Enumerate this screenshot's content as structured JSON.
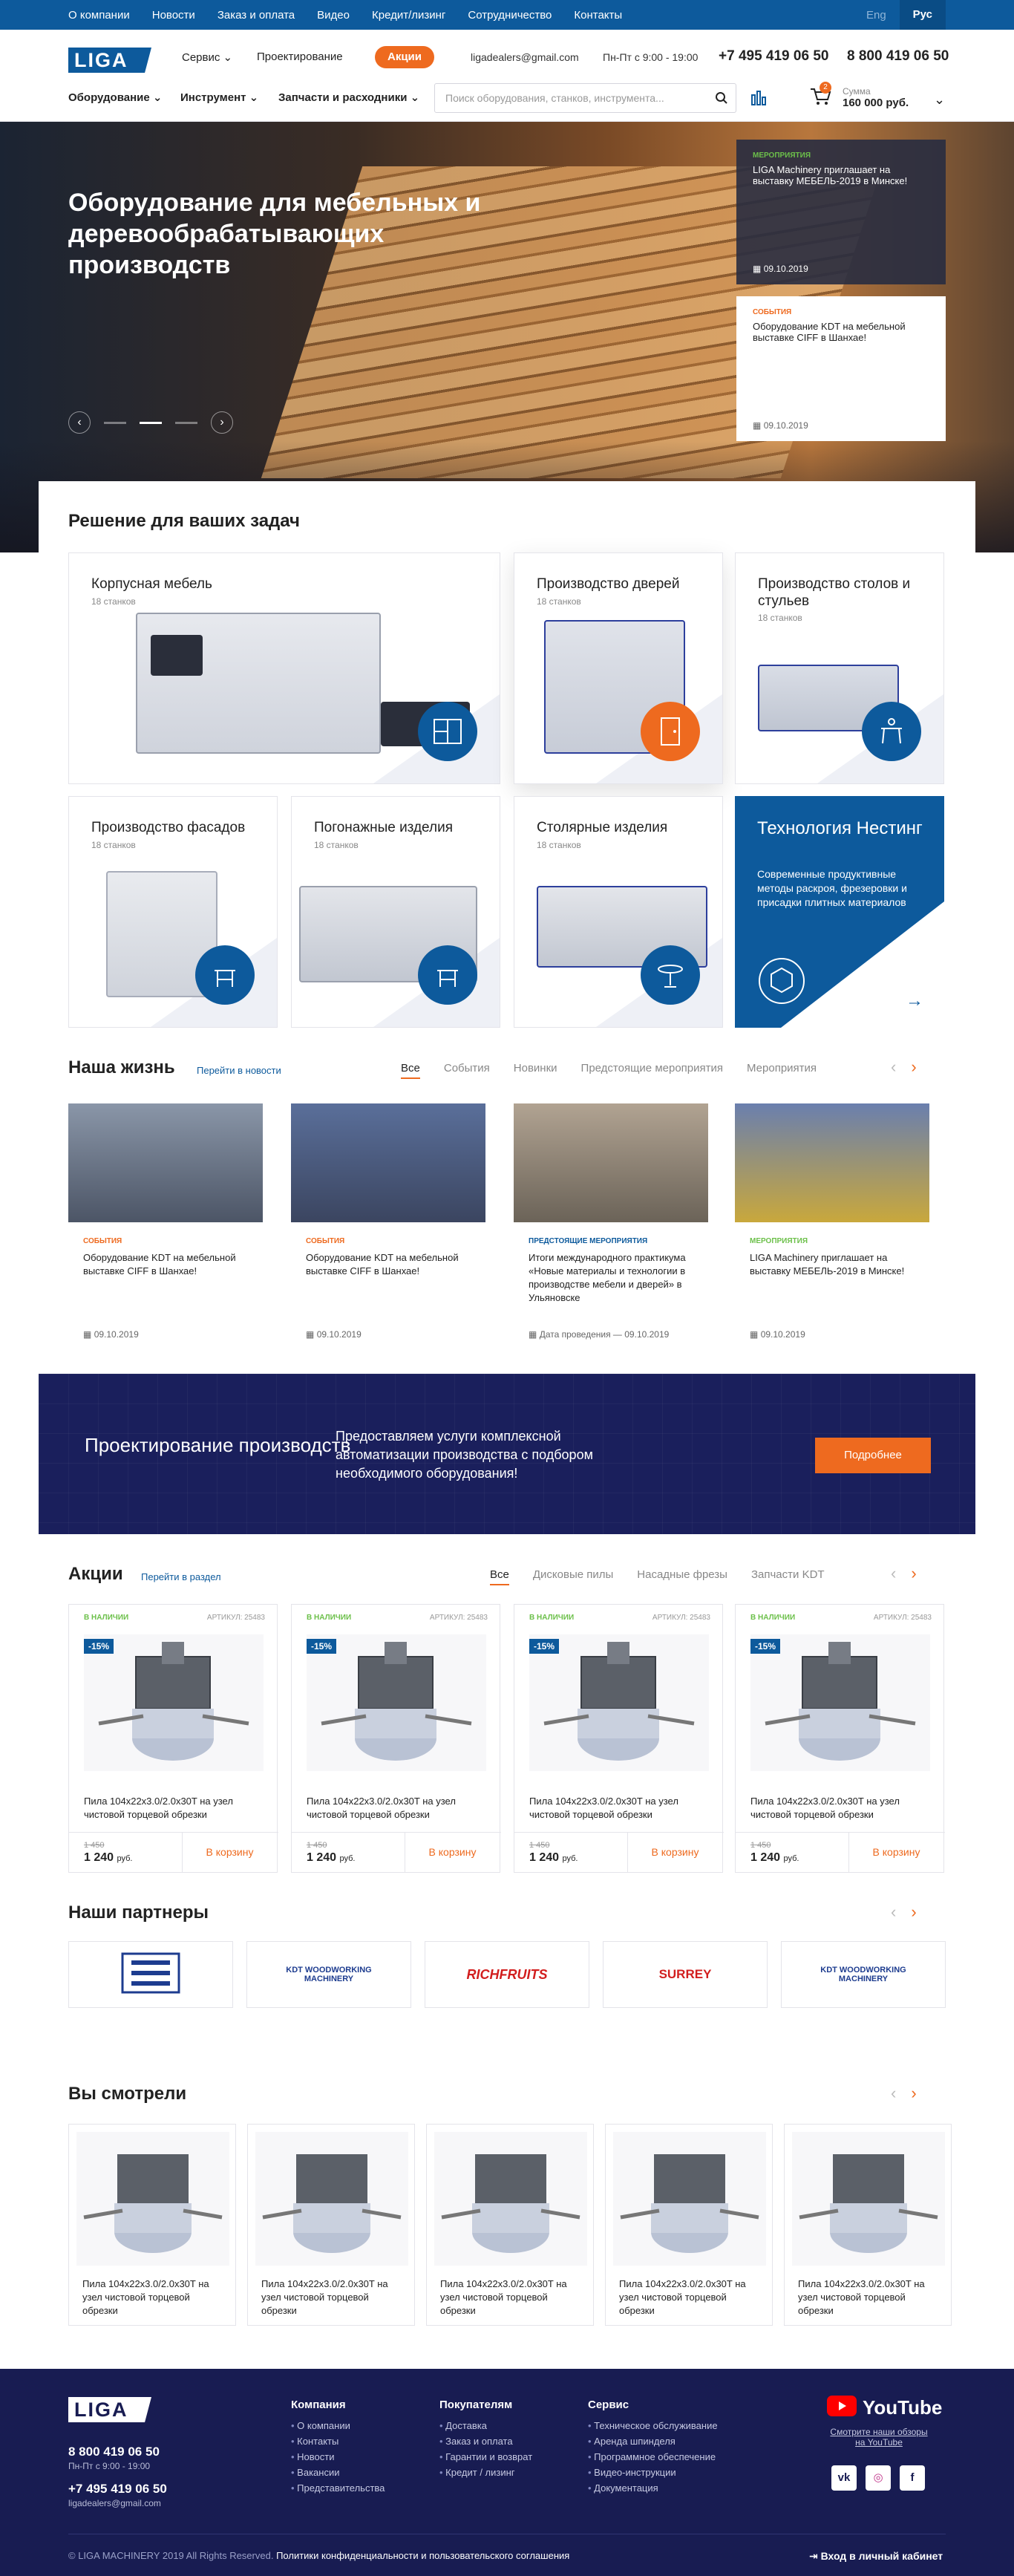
{
  "topbar": {
    "links": [
      "О компании",
      "Новости",
      "Заказ и оплата",
      "Видео",
      "Кредит/лизинг",
      "Сотрудничество",
      "Контакты"
    ],
    "lang_eng": "Eng",
    "lang_rus": "Рус"
  },
  "header": {
    "logo": "LIGA",
    "service": "Сервис",
    "design": "Проектирование",
    "promo": "Акции",
    "email": "ligadealers@gmail.com",
    "hours": "Пн-Пт с 9:00 - 19:00",
    "phone1": "+7 495 419 06 50",
    "phone2": "8 800 419 06 50",
    "menu": [
      "Оборудование",
      "Инструмент",
      "Запчасти и расходники"
    ],
    "search_placeholder": "Поиск оборудования, станков, инструмента...",
    "cart_count": "2",
    "cart_label": "Сумма",
    "cart_sum": "160 000 руб."
  },
  "hero": {
    "title": "Оборудование для мебельных и деревообрабатывающих производств",
    "prev": "‹",
    "next": "›",
    "news": [
      {
        "category": "МЕРОПРИЯТИЯ",
        "text": "LIGA Machinery приглашает на выставку МЕБЕЛЬ-2019 в Минске!",
        "date": "09.10.2019"
      },
      {
        "category": "СОБЫТИЯ",
        "text": "Оборудование KDT на мебельной выставке CIFF в Шанхае!",
        "date": "09.10.2019"
      }
    ]
  },
  "solutions": {
    "title": "Решение для ваших задач",
    "cards": [
      {
        "title": "Корпусная мебель",
        "sub": "18 станков"
      },
      {
        "title": "Производство дверей",
        "sub": "18 станков"
      },
      {
        "title": "Производство столов и стульев",
        "sub": "18 станков"
      },
      {
        "title": "Производство фасадов",
        "sub": "18 станков"
      },
      {
        "title": "Погонажные изделия",
        "sub": "18 станков"
      },
      {
        "title": "Столярные изделия",
        "sub": "18 станков"
      }
    ],
    "nesting_title": "Технология Нестинг",
    "nesting_text": "Современные продуктивные методы раскроя, фрезеровки и присадки плитных материалов"
  },
  "life": {
    "title": "Наша жизнь",
    "link": "Перейти в новости",
    "tabs": [
      "Все",
      "События",
      "Новинки",
      "Предстоящие мероприятия",
      "Мероприятия"
    ],
    "items": [
      {
        "category": "СОБЫТИЯ",
        "text": "Оборудование KDT на мебельной выставке CIFF в Шанхае!",
        "date": "09.10.2019",
        "color": "#ee6a1f"
      },
      {
        "category": "СОБЫТИЯ",
        "text": "Оборудование KDT на мебельной выставке CIFF в Шанхае!",
        "date": "09.10.2019",
        "color": "#ee6a1f"
      },
      {
        "category": "ПРЕДСТОЯЩИЕ МЕРОПРИЯТИЯ",
        "text": "Итоги международного практикума «Новые материалы и технологии в производстве мебели и дверей» в Ульяновске",
        "date": "Дата проведения — 09.10.2019",
        "color": "#0d5a9c"
      },
      {
        "category": "МЕРОПРИЯТИЯ",
        "text": "LIGA Machinery приглашает на выставку МЕБЕЛЬ-2019 в Минске!",
        "date": "09.10.2019",
        "color": "#6cc04a"
      }
    ]
  },
  "banner": {
    "title": "Проектирование производств",
    "text": "Предоставляем услуги комплексной автоматизации производства с подбором необходимого оборудования!",
    "button": "Подробнее"
  },
  "sales": {
    "title": "Акции",
    "link": "Перейти в раздел",
    "tabs": [
      "Все",
      "Дисковые пилы",
      "Насадные фрезы",
      "Запчасти KDT"
    ],
    "products": [
      {
        "availability": "В НАЛИЧИИ",
        "article": "АРТИКУЛ: 25483",
        "discount": "-15%",
        "name": "Пила 104x22x3.0/2.0x30T на узел чистовой торцевой обрезки",
        "old_price": "1 450",
        "price": "1 240",
        "currency": "руб.",
        "cart": "В корзину"
      },
      {
        "availability": "В НАЛИЧИИ",
        "article": "АРТИКУЛ: 25483",
        "discount": "-15%",
        "name": "Пила 104x22x3.0/2.0x30T на узел чистовой торцевой обрезки",
        "old_price": "1 450",
        "price": "1 240",
        "currency": "руб.",
        "cart": "В корзину"
      },
      {
        "availability": "В НАЛИЧИИ",
        "article": "АРТИКУЛ: 25483",
        "discount": "-15%",
        "name": "Пила 104x22x3.0/2.0x30T на узел чистовой торцевой обрезки",
        "old_price": "1 450",
        "price": "1 240",
        "currency": "руб.",
        "cart": "В корзину"
      },
      {
        "availability": "В НАЛИЧИИ",
        "article": "АРТИКУЛ: 25483",
        "discount": "-15%",
        "name": "Пила 104x22x3.0/2.0x30T на узел чистовой торцевой обрезки",
        "old_price": "1 450",
        "price": "1 240",
        "currency": "руб.",
        "cart": "В корзину"
      }
    ]
  },
  "partners": {
    "title": "Наши партнеры",
    "logos": [
      "KDT WOODWORKING MACHINERY",
      "RICHFRUITS",
      "SURREY",
      "KDT WOODWORKING MACHINERY"
    ]
  },
  "viewed": {
    "title": "Вы смотрели",
    "items": [
      "Пила 104x22x3.0/2.0x30T на узел чистовой торцевой обрезки",
      "Пила 104x22x3.0/2.0x30T на узел чистовой торцевой обрезки",
      "Пила 104x22x3.0/2.0x30T на узел чистовой торцевой обрезки",
      "Пила 104x22x3.0/2.0x30T на узел чистовой торцевой обрезки",
      "Пила 104x22x3.0/2.0x30T на узел чистовой торцевой обрезки"
    ]
  },
  "footer": {
    "logo": "LIGA",
    "phone1": "8 800 419 06 50",
    "hours": "Пн-Пт с 9:00 - 19:00",
    "phone2": "+7 495 419 06 50",
    "email": "ligadealers@gmail.com",
    "col1": {
      "title": "Компания",
      "items": [
        "О компании",
        "Контакты",
        "Новости",
        "Вакансии",
        "Представительства"
      ]
    },
    "col2": {
      "title": "Покупателям",
      "items": [
        "Доставка",
        "Заказ и оплата",
        "Гарантии и возврат",
        "Кредит / лизинг"
      ]
    },
    "col3": {
      "title": "Сервис",
      "items": [
        "Техническое обслуживание",
        "Аренда шпинделя",
        "Программное обеспечение",
        "Видео-инструкции",
        "Документация"
      ]
    },
    "youtube": "YouTube",
    "youtube_text": "Смотрите наши обзоры на YouTube",
    "copyright": "© LIGA MACHINERY 2019 All Rights Reserved.",
    "policy": "Политики конфиденциальности и пользовательского соглашения",
    "cabinet": "Вход в личный кабинет"
  },
  "colors": {
    "brand": "#0d5a9c",
    "accent": "#ee6a1f",
    "dark": "#181c52"
  }
}
